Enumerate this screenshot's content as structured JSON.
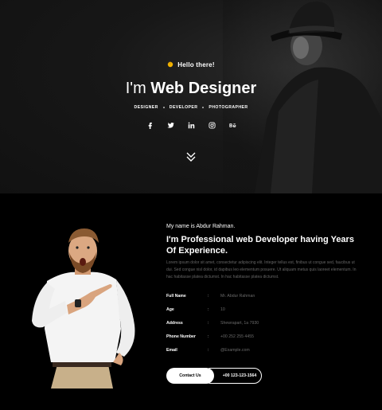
{
  "hero": {
    "greeting": "Hello there!",
    "title_prefix": "I'm",
    "title_strong": "Web Designer",
    "roles": [
      "DESIGNER",
      "DEVELOPER",
      "PHOTOGRAPHER"
    ],
    "socials": [
      "facebook-icon",
      "twitter-icon",
      "linkedin-icon",
      "instagram-icon",
      "behance-icon"
    ]
  },
  "about": {
    "intro": "My name is Abdur Rahman.",
    "headline": "I'm Professional web Developer having Years Of Experience.",
    "paragraph": "Lorem ipsum dolor sit amet, consectetur adipiscing elit. Integer tellus est, finibus ut congue sed, faucibus ut dui. Sed congue nisl dolor, id dapibus leo elementum posuere. Ut aliquam metus quis laoreet elementum. In hac habitasse platea dictumst. In hac habitasse platea dictumst.",
    "details": [
      {
        "label": "Full Name",
        "value": "Mr. Abdur Rahman"
      },
      {
        "label": "Age",
        "value": "10"
      },
      {
        "label": "Address",
        "value": "Shewrapart, 1a 7930"
      },
      {
        "label": "Phone Number",
        "value": "+00 252 255 4455"
      },
      {
        "label": "Email",
        "value": "@Example.com"
      }
    ],
    "contact_label": "Contact Us",
    "phone_label": "+00 123-123-1564"
  }
}
